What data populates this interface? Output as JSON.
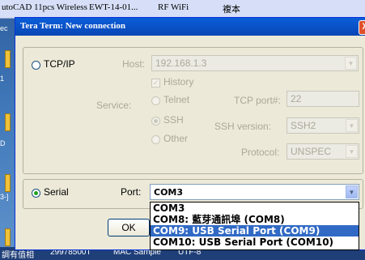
{
  "taskbar_top": {
    "items": [
      "utoCAD",
      "11pcs Wireless",
      "EWT-14-01...",
      "RF WiFi",
      "複本"
    ]
  },
  "taskbar_bottom": {
    "items": [
      "調有值相",
      "29978500T",
      "MAC Sample",
      "UTF-8"
    ]
  },
  "side_marks": [
    "ec",
    "1",
    "D",
    "3-]"
  ],
  "dialog": {
    "title": "Tera Term: New connection",
    "close": "X"
  },
  "tcpip": {
    "label": "TCP/IP",
    "host_label": "Host:",
    "host_value": "192.168.1.3",
    "history_label": "History",
    "service_label": "Service:",
    "telnet_label": "Telnet",
    "ssh_label": "SSH",
    "other_label": "Other",
    "tcp_port_label": "TCP port#:",
    "tcp_port_value": "22",
    "ssh_version_label": "SSH version:",
    "ssh_version_value": "SSH2",
    "protocol_label": "Protocol:",
    "protocol_value": "UNSPEC"
  },
  "serial": {
    "label": "Serial",
    "port_label": "Port:",
    "port_value": "COM3",
    "options": [
      {
        "label": "COM3",
        "selected": false
      },
      {
        "label": "COM8: 藍芽通訊埠 (COM8)",
        "selected": false
      },
      {
        "label": "COM9: USB Serial Port (COM9)",
        "selected": true
      },
      {
        "label": "COM10: USB Serial Port (COM10)",
        "selected": false
      }
    ]
  },
  "buttons": {
    "ok": "OK"
  },
  "colors": {
    "title_bar": "#0a52c8",
    "selection": "#316ac5",
    "dialog_bg": "#ece9d8"
  }
}
